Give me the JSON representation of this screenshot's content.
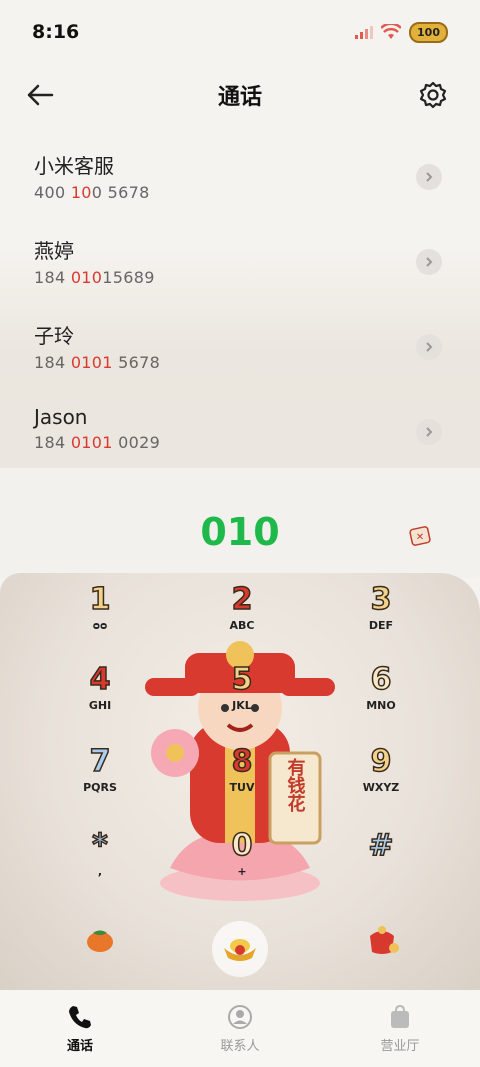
{
  "status_bar": {
    "time": "8:16",
    "battery": "100"
  },
  "header": {
    "title": "通话"
  },
  "contacts": [
    {
      "name": "小米客服",
      "number_pre": "400 ",
      "number_hl": "10",
      "number_post": "0 5678"
    },
    {
      "name": "燕婷",
      "number_pre": "184 ",
      "number_hl": "010",
      "number_post": "15689"
    },
    {
      "name": "子玲",
      "number_pre": "184 ",
      "number_hl": "0101",
      "number_post": " 5678"
    },
    {
      "name": "Jason",
      "number_pre": "184 ",
      "number_hl": "0101",
      "number_post": " 0029"
    }
  ],
  "dial": {
    "number": "010"
  },
  "keys": [
    {
      "digit": "1",
      "letters": "ᴑᴑ"
    },
    {
      "digit": "2",
      "letters": "ABC"
    },
    {
      "digit": "3",
      "letters": "DEF"
    },
    {
      "digit": "4",
      "letters": "GHI"
    },
    {
      "digit": "5",
      "letters": "JKL"
    },
    {
      "digit": "6",
      "letters": "MNO"
    },
    {
      "digit": "7",
      "letters": "PQRS"
    },
    {
      "digit": "8",
      "letters": "TUV"
    },
    {
      "digit": "9",
      "letters": "WXYZ"
    },
    {
      "digit": "*",
      "letters": ","
    },
    {
      "digit": "0",
      "letters": "+"
    },
    {
      "digit": "#",
      "letters": ""
    }
  ],
  "mascot": {
    "scroll_text": "有钱花"
  },
  "nav": [
    {
      "label": "通话"
    },
    {
      "label": "联系人"
    },
    {
      "label": "营业厅"
    }
  ],
  "colors": {
    "accent_green": "#1fb84a",
    "highlight_red": "#d93a2f"
  }
}
